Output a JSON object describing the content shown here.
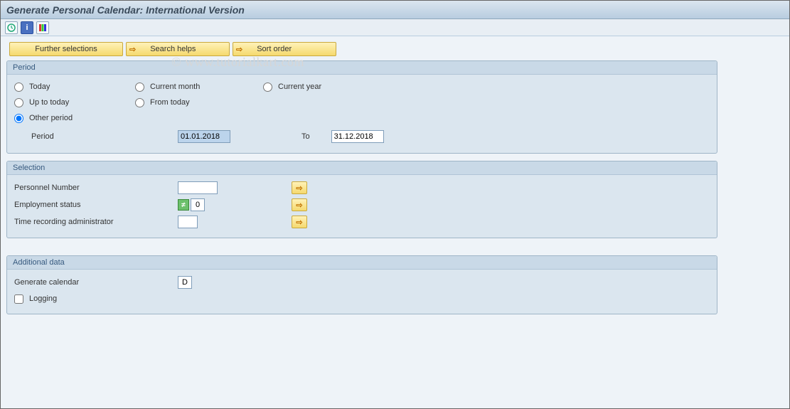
{
  "title": "Generate Personal Calendar: International Version",
  "watermark": "© www.tutorialkart.com",
  "toolbar_buttons": {
    "further_selections": "Further selections",
    "search_helps": "Search helps",
    "sort_order": "Sort order"
  },
  "groups": {
    "period": {
      "title": "Period",
      "radios": {
        "today": "Today",
        "current_month": "Current month",
        "current_year": "Current year",
        "up_to_today": "Up to today",
        "from_today": "From today",
        "other_period": "Other period"
      },
      "selected": "other_period",
      "period_label": "Period",
      "from_value": "01.01.2018",
      "to_label": "To",
      "to_value": "31.12.2018"
    },
    "selection": {
      "title": "Selection",
      "rows": {
        "personnel_number": {
          "label": "Personnel Number",
          "value": ""
        },
        "employment_status": {
          "label": "Employment status",
          "value": "0",
          "ne_indicator": true
        },
        "time_rec_admin": {
          "label": "Time recording administrator",
          "value": ""
        }
      }
    },
    "additional": {
      "title": "Additional data",
      "generate_calendar_label": "Generate calendar",
      "generate_calendar_value": "D",
      "logging_label": "Logging",
      "logging_checked": false
    }
  }
}
